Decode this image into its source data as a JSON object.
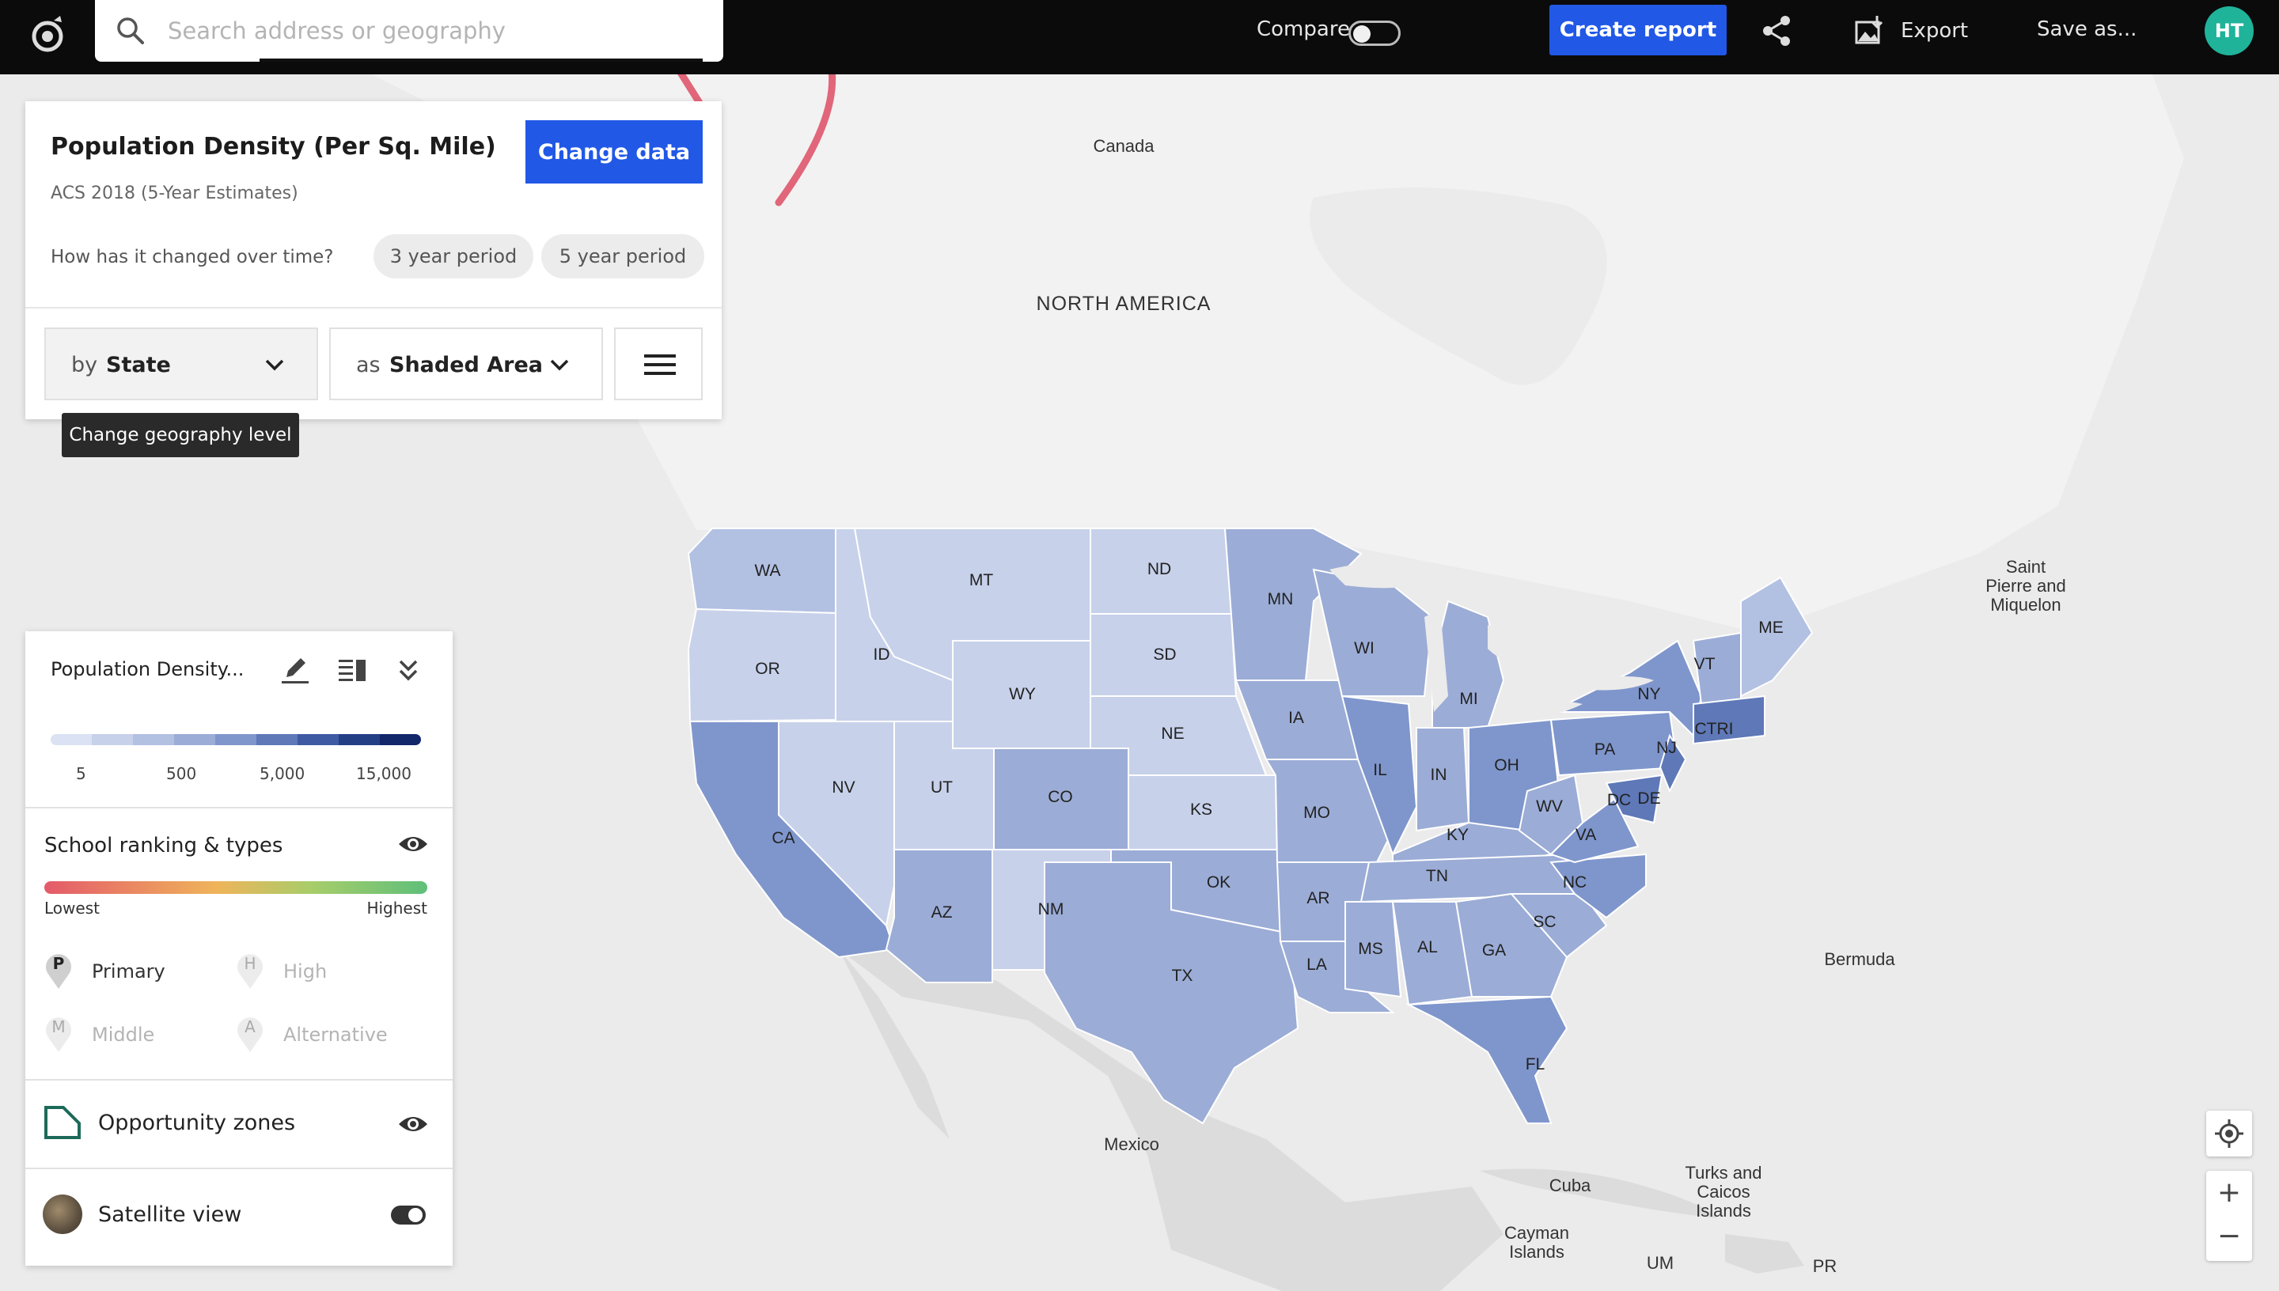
{
  "topbar": {
    "search_placeholder": "Search address or geography",
    "compare_label": "Compare",
    "create_report": "Create report",
    "export_label": "Export",
    "save_as": "Save as...",
    "avatar_initials": "HT"
  },
  "data_panel": {
    "title": "Population Density (Per Sq. Mile)",
    "subtitle": "ACS 2018 (5-Year Estimates)",
    "change_data": "Change data",
    "change_question": "How has it changed over time?",
    "period_3": "3 year period",
    "period_5": "5 year period",
    "geo_prefix": "by",
    "geo_value": "State",
    "style_prefix": "as",
    "style_value": "Shaded Area",
    "tooltip": "Change geography level"
  },
  "legend": {
    "title": "Population Density...",
    "scale_ticks": [
      "5",
      "500",
      "5,000",
      "15,000"
    ],
    "school_title": "School ranking & types",
    "lowest": "Lowest",
    "highest": "Highest",
    "school_types": [
      {
        "letter": "P",
        "label": "Primary",
        "active": true
      },
      {
        "letter": "H",
        "label": "High",
        "active": false
      },
      {
        "letter": "M",
        "label": "Middle",
        "active": false
      },
      {
        "letter": "A",
        "label": "Alternative",
        "active": false
      }
    ],
    "opportunity_zones": "Opportunity zones",
    "satellite_view": "Satellite view"
  },
  "map": {
    "places": [
      "Canada",
      "NORTH AMERICA",
      "Saint Pierre and Miquelon",
      "Bermuda",
      "Mexico",
      "Cuba",
      "Turks and Caicos Islands",
      "Cayman Islands",
      "UM",
      "PR"
    ],
    "states": [
      "WA",
      "MT",
      "ND",
      "MN",
      "ME",
      "OR",
      "ID",
      "SD",
      "WI",
      "VT",
      "NY",
      "MI",
      "WY",
      "NE",
      "IA",
      "CTRI",
      "PA",
      "NJ",
      "NV",
      "UT",
      "CO",
      "IL",
      "IN",
      "OH",
      "CA",
      "KS",
      "MO",
      "WV",
      "DC",
      "DE",
      "KY",
      "VA",
      "TN",
      "NC",
      "OK",
      "AR",
      "AZ",
      "NM",
      "SC",
      "TX",
      "MS",
      "AL",
      "GA",
      "LA",
      "FL"
    ],
    "zoom_in": "+",
    "zoom_out": "−",
    "colors": {
      "lightest": "#c7d1ea",
      "light": "#b2c0e2",
      "mid": "#9bacd6",
      "dark": "#7f96cc",
      "darkest": "#5e78b8"
    }
  }
}
